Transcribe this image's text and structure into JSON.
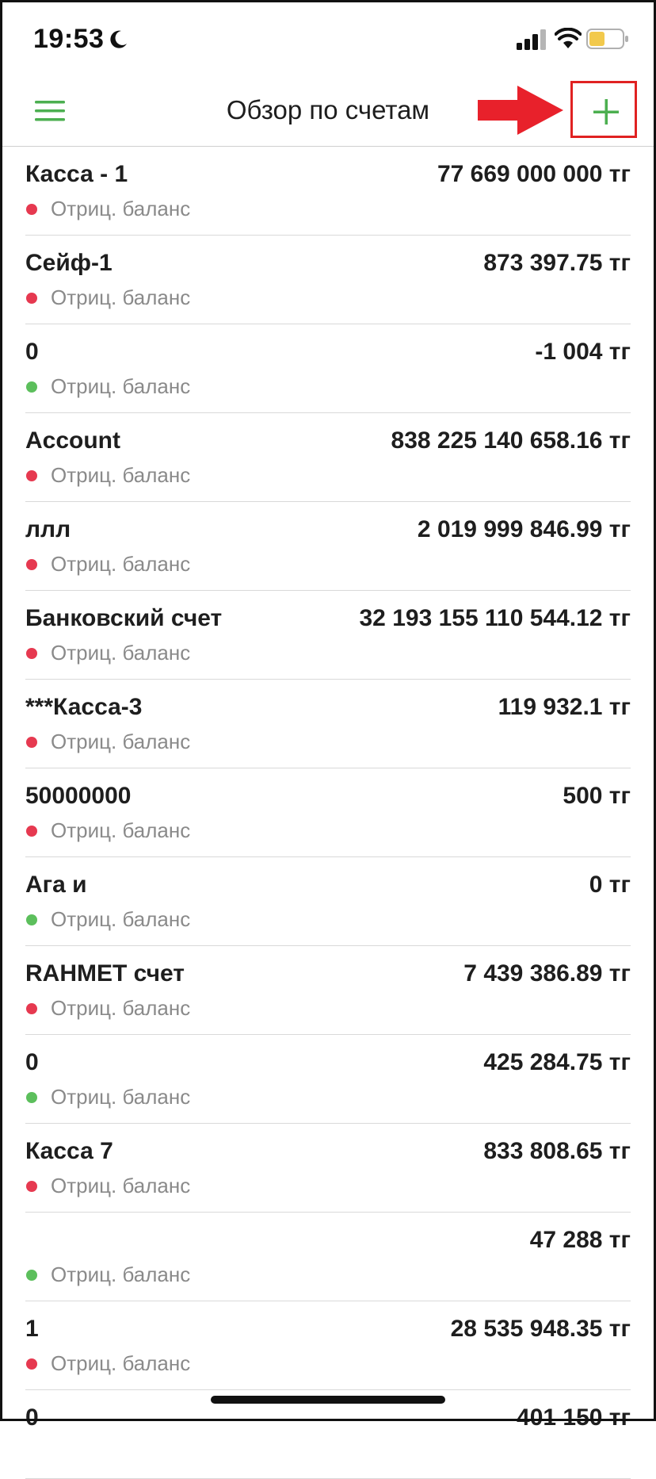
{
  "status_bar": {
    "time": "19:53",
    "icons": [
      "moon-icon",
      "signal-icon",
      "wifi-icon",
      "battery-icon"
    ]
  },
  "nav": {
    "title": "Обзор по счетам",
    "menu_icon": "hamburger-menu-icon",
    "add_icon": "plus-icon",
    "annotation_icon": "red-arrow-icon"
  },
  "colors": {
    "accent_green": "#4caf50",
    "negative_red": "#e63950",
    "positive_green": "#5cbf5c",
    "annotation_red": "#e02222"
  },
  "accounts": [
    {
      "name": "Касса - 1",
      "amount": "77 669 000 000 тг",
      "status": "Отриц. баланс",
      "dot": "red"
    },
    {
      "name": "Сейф-1",
      "amount": "873 397.75 тг",
      "status": "Отриц. баланс",
      "dot": "red"
    },
    {
      "name": "0",
      "amount": "-1 004 тг",
      "status": "Отриц. баланс",
      "dot": "green"
    },
    {
      "name": "Account",
      "amount": "838 225 140 658.16 тг",
      "status": "Отриц. баланс",
      "dot": "red"
    },
    {
      "name": "ллл",
      "amount": "2 019 999 846.99 тг",
      "status": "Отриц. баланс",
      "dot": "red"
    },
    {
      "name": "Банковский счет",
      "amount": "32 193 155 110 544.12 тг",
      "status": "Отриц. баланс",
      "dot": "red"
    },
    {
      "name": "***Касса-3",
      "amount": "119 932.1 тг",
      "status": "Отриц. баланс",
      "dot": "red"
    },
    {
      "name": "50000000",
      "amount": "500 тг",
      "status": "Отриц. баланс",
      "dot": "red"
    },
    {
      "name": "Ага и",
      "amount": "0 тг",
      "status": "Отриц. баланс",
      "dot": "green"
    },
    {
      "name": "RAHMET счет",
      "amount": "7 439 386.89 тг",
      "status": "Отриц. баланс",
      "dot": "red"
    },
    {
      "name": "0",
      "amount": "425 284.75 тг",
      "status": "Отриц. баланс",
      "dot": "green"
    },
    {
      "name": "Касса 7",
      "amount": "833 808.65 тг",
      "status": "Отриц. баланс",
      "dot": "red"
    },
    {
      "name": "",
      "amount": "47 288 тг",
      "status": "Отриц. баланс",
      "dot": "green"
    },
    {
      "name": "1",
      "amount": "28 535 948.35 тг",
      "status": "Отриц. баланс",
      "dot": "red"
    },
    {
      "name": "0",
      "amount": "401 150 тг",
      "status": "",
      "dot": ""
    }
  ]
}
